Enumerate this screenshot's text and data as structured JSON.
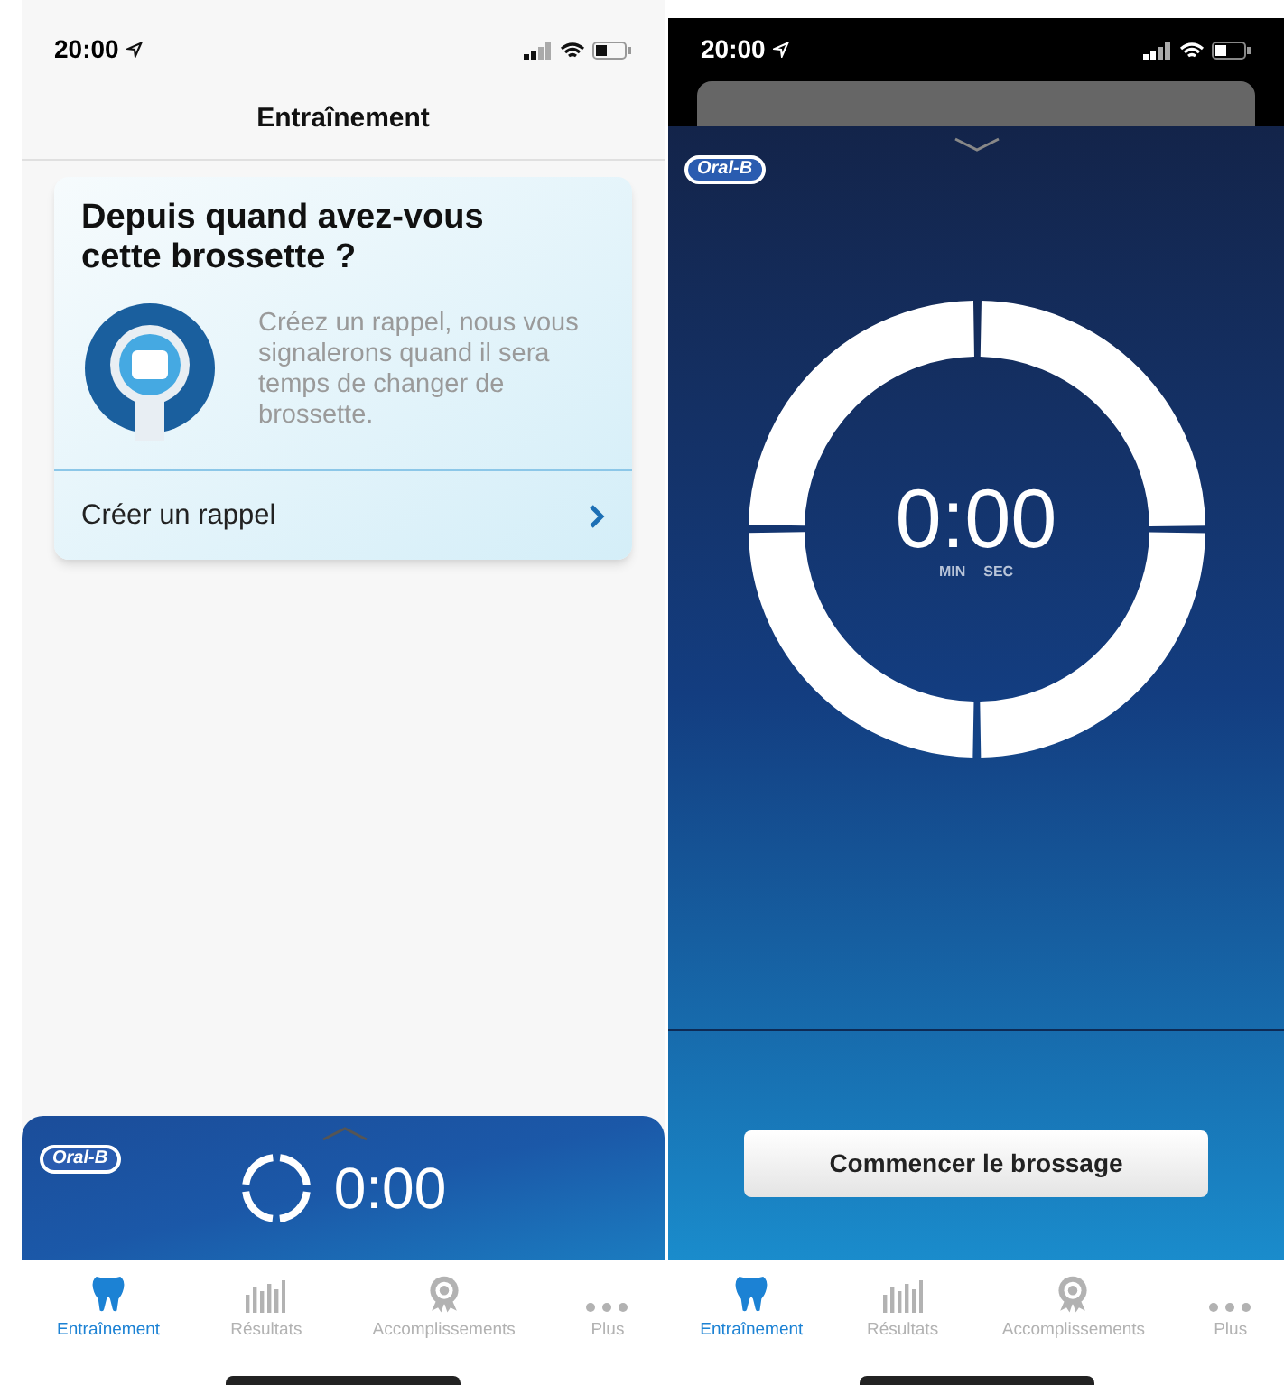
{
  "screens": [
    {
      "kind": "home",
      "status_time": "20:00",
      "title": "Entraînement",
      "card": {
        "heading": "Depuis quand avez-vous cette brossette ?",
        "text": "Créez un rappel, nous vous signalerons quand il sera temps de changer de brossette.",
        "action": "Créer un rappel"
      },
      "player": {
        "logo": "Oral-B",
        "time": "0:00"
      },
      "tabs": [
        {
          "label": "Entraînement",
          "selected": true
        },
        {
          "label": "Résultats",
          "selected": false
        },
        {
          "label": "Accomplissements",
          "selected": false
        },
        {
          "label": "Plus",
          "selected": false
        }
      ]
    },
    {
      "kind": "timer",
      "status_time": "20:00",
      "player": {
        "logo": "Oral-B",
        "time": "0:00",
        "min_label": "MIN",
        "sec_label": "SEC"
      },
      "start_button": "Commencer le brossage",
      "tabs": [
        {
          "label": "Entraînement",
          "selected": true
        },
        {
          "label": "Résultats",
          "selected": false
        },
        {
          "label": "Accomplissements",
          "selected": false
        },
        {
          "label": "Plus",
          "selected": false
        }
      ]
    }
  ]
}
